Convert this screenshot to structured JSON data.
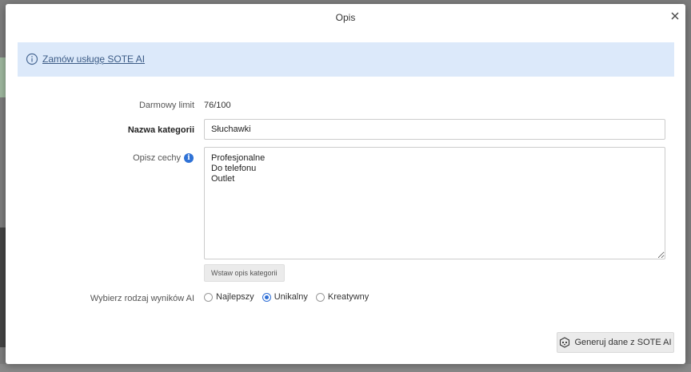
{
  "modal": {
    "title": "Opis"
  },
  "info": {
    "link_text": "Zamów usługę SOTE AI"
  },
  "form": {
    "limit_label": "Darmowy limit",
    "limit_value": "76/100",
    "name_label": "Nazwa kategorii",
    "name_value": "Słuchawki",
    "desc_label": "Opisz cechy",
    "desc_value": "Profesjonalne\nDo telefonu\nOutlet",
    "insert_button": "Wstaw opis kategorii",
    "result_label": "Wybierz rodzaj wyników AI",
    "options": [
      "Najlepszy",
      "Unikalny",
      "Kreatywny"
    ],
    "selected_option": "Unikalny"
  },
  "actions": {
    "generate_button": "Generuj dane z SOTE AI"
  },
  "colors": {
    "info_bg": "#dce9fa",
    "accent": "#2f6fd6"
  },
  "icons": [
    "info-icon",
    "close-icon",
    "hint-icon",
    "ai-icon"
  ]
}
